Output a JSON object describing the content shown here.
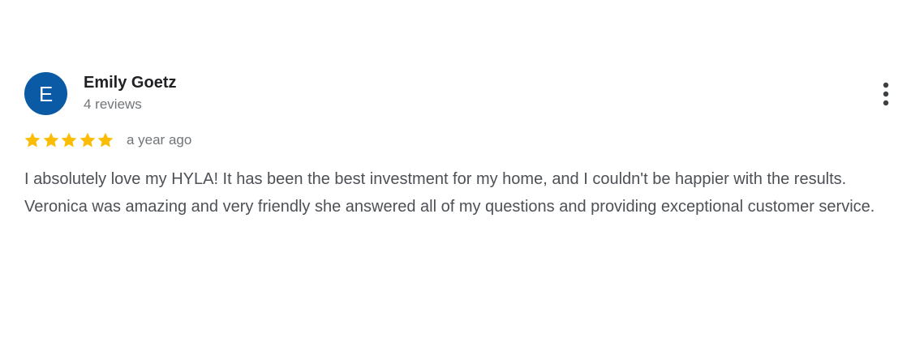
{
  "review": {
    "avatar_letter": "E",
    "avatar_color": "#0b5aa5",
    "reviewer_name": "Emily Goetz",
    "review_count": "4 reviews",
    "rating": 5,
    "rating_max": 5,
    "star_color": "#fbbc04",
    "timestamp": "a year ago",
    "text": "I absolutely love my HYLA! It has been the best investment for my home, and I couldn't be happier with the results. Veronica was amazing and very friendly she answered all of my questions and providing exceptional customer service.",
    "more_icon": "more-vert-icon"
  }
}
